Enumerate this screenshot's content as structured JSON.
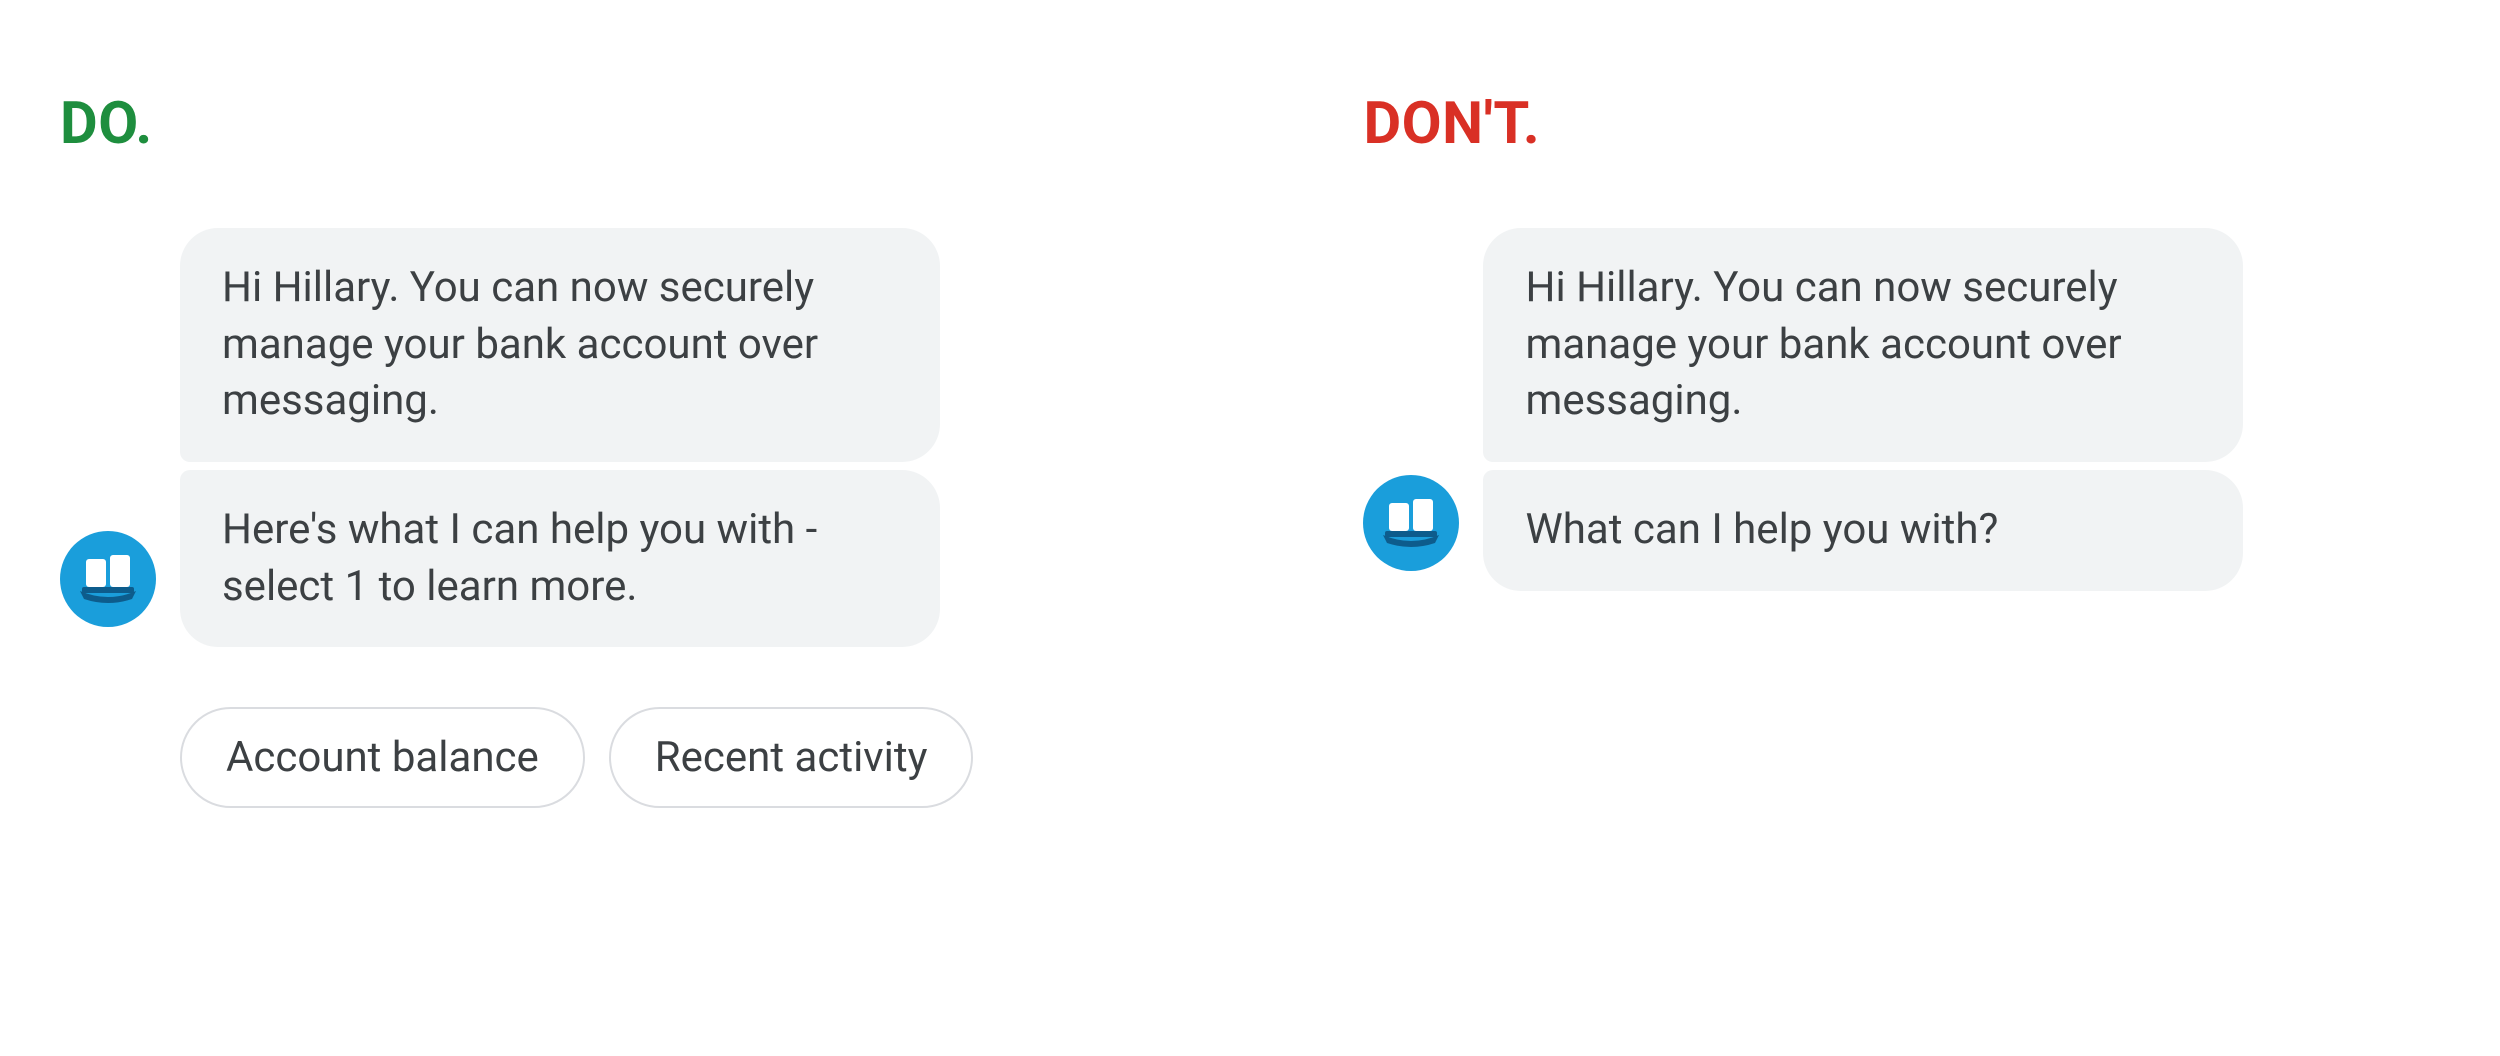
{
  "do": {
    "heading": "DO.",
    "messages": [
      "Hi Hillary. You can now securely manage your bank account over messaging.",
      "Here's what I can help you with - select 1 to learn more."
    ],
    "chips": [
      "Account balance",
      "Recent activity"
    ]
  },
  "dont": {
    "heading": "DON'T.",
    "messages": [
      "Hi Hillary. You can now securely manage your bank account over messaging.",
      "What can I help you with?"
    ]
  },
  "colors": {
    "do": "#1e8e3e",
    "dont": "#d93025",
    "bubble_bg": "#f1f3f4",
    "text": "#3c4043",
    "avatar_bg": "#1a9edb",
    "chip_border": "#dadce0"
  }
}
